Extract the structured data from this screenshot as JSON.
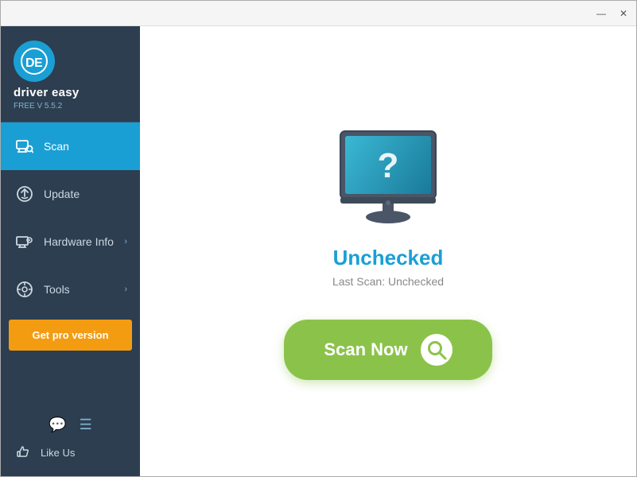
{
  "titleBar": {
    "minimize_label": "—",
    "close_label": "✕"
  },
  "sidebar": {
    "logo": {
      "app_name": "driver easy",
      "version": "FREE V 5.5.2"
    },
    "nav_items": [
      {
        "id": "scan",
        "label": "Scan",
        "active": true,
        "has_chevron": false
      },
      {
        "id": "update",
        "label": "Update",
        "active": false,
        "has_chevron": false
      },
      {
        "id": "hardware-info",
        "label": "Hardware Info",
        "active": false,
        "has_chevron": true
      },
      {
        "id": "tools",
        "label": "Tools",
        "active": false,
        "has_chevron": true
      }
    ],
    "pro_button_label": "Get pro version",
    "like_us_label": "Like Us"
  },
  "mainPanel": {
    "status_title": "Unchecked",
    "last_scan_label": "Last Scan: Unchecked",
    "scan_now_label": "Scan Now"
  }
}
